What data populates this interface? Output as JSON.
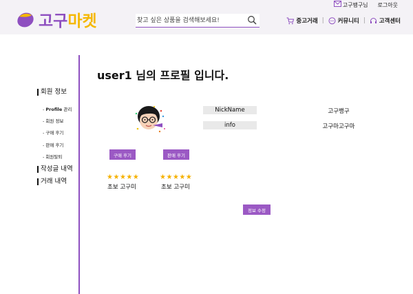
{
  "header": {
    "logo_text_a": "고구",
    "logo_text_b": "마켓",
    "search_placeholder": "찾고 싶은 상품을 검색해보세요!",
    "user_link": "고구뱅구님",
    "logout": "로그아웃",
    "nav": [
      "중고거래",
      "커뮤니티",
      "고객센터"
    ],
    "nav_sep": "|"
  },
  "sidebar": {
    "member_info": "회원 정보",
    "items": [
      {
        "bold": "Profile",
        "rest": " 관리"
      },
      {
        "bold": "",
        "rest": "회원 정보"
      },
      {
        "bold": "",
        "rest": "구매 후기"
      },
      {
        "bold": "",
        "rest": "판매 후기"
      },
      {
        "bold": "",
        "rest": "회원탈퇴"
      }
    ],
    "bullet": "- ",
    "posts": "작성글 내역",
    "trades": "거래 내역"
  },
  "main": {
    "title": "user1 님의 프로필 입니다.",
    "buy_review_btn": "구매 후기",
    "sell_review_btn": "판매 후기",
    "buy_grade": "초보 고구미",
    "sell_grade": "초보 고구미",
    "buy_rating": 5,
    "sell_rating": 5,
    "fields": [
      {
        "label": "NickName",
        "value": "고구뱅구"
      },
      {
        "label": "info",
        "value": "고구마고구마"
      }
    ],
    "edit_btn": "정보 수정"
  },
  "colors": {
    "brand_purple": "#8e4fc0",
    "button_purple": "#9b59c4",
    "logo_yellow": "#f5b800",
    "star": "#f5b100"
  }
}
